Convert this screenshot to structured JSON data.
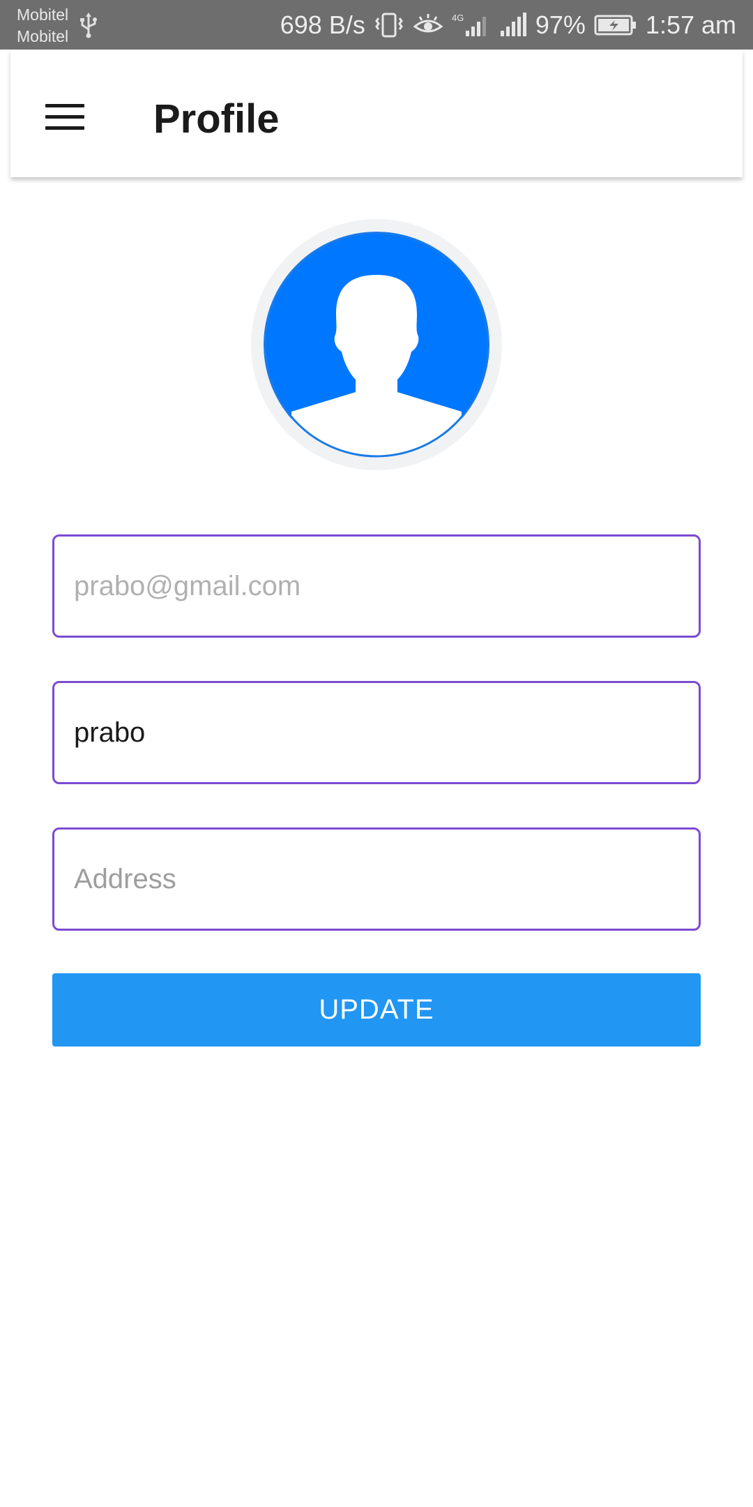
{
  "status_bar": {
    "carrier_1": "Mobitel",
    "carrier_2": "Mobitel",
    "net_speed": "698 B/s",
    "network_type": "4G",
    "battery_percent": "97%",
    "time": "1:57 am"
  },
  "app_bar": {
    "title": "Profile"
  },
  "form": {
    "email_placeholder": "prabo@gmail.com",
    "name_value": "prabo",
    "address_placeholder": "Address",
    "update_label": "UPDATE"
  },
  "colors": {
    "accent": "#2196f3",
    "field_border": "#7b4bd1",
    "avatar_blue": "#0077ff"
  },
  "icons": {
    "menu": "hamburger-icon",
    "avatar": "person-silhouette-icon"
  }
}
